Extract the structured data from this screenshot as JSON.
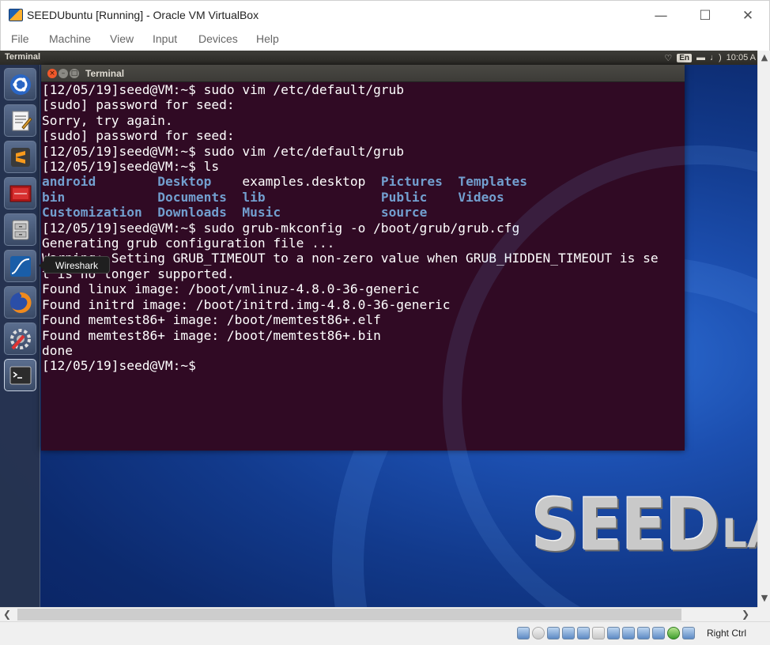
{
  "window": {
    "title": "SEEDUbuntu [Running] - Oracle VM VirtualBox",
    "controls": {
      "minimize": "—",
      "maximize": "☐",
      "close": "✕"
    }
  },
  "menu": [
    "File",
    "Machine",
    "View",
    "Input",
    "Devices",
    "Help"
  ],
  "panel": {
    "app_name": "Terminal",
    "keyboard": "En",
    "clock": "10:05 A"
  },
  "launcher": {
    "items": [
      "ubuntu-dash",
      "text-editor",
      "sublime-text",
      "terminal-red",
      "file-manager",
      "wireshark",
      "firefox",
      "system-settings",
      "terminal"
    ],
    "tooltip": "Wireshark"
  },
  "terminal": {
    "title": "Terminal",
    "lines": [
      "[12/05/19]seed@VM:~$ sudo vim /etc/default/grub",
      "[sudo] password for seed:",
      "Sorry, try again.",
      "[sudo] password for seed:",
      "[12/05/19]seed@VM:~$ sudo vim /etc/default/grub",
      "[12/05/19]seed@VM:~$ ls"
    ],
    "ls_rows": [
      [
        "android",
        "Desktop",
        "examples.desktop",
        "Pictures",
        "Templates"
      ],
      [
        "bin",
        "Documents",
        "lib",
        "Public",
        "Videos"
      ],
      [
        "Customization",
        "Downloads",
        "Music",
        "source",
        ""
      ]
    ],
    "lines_after": [
      "[12/05/19]seed@VM:~$ sudo grub-mkconfig -o /boot/grub/grub.cfg",
      "Generating grub configuration file ...",
      "Warning: Setting GRUB_TIMEOUT to a non-zero value when GRUB_HIDDEN_TIMEOUT is se",
      "t is no longer supported.",
      "Found linux image: /boot/vmlinuz-4.8.0-36-generic",
      "Found initrd image: /boot/initrd.img-4.8.0-36-generic",
      "Found memtest86+ image: /boot/memtest86+.elf",
      "Found memtest86+ image: /boot/memtest86+.bin",
      "done",
      "[12/05/19]seed@VM:~$ "
    ],
    "colors": {
      "background": "#300a24",
      "text": "#ffffff",
      "directory": "#729fcf"
    }
  },
  "wallpaper": {
    "logo_big": "SEED",
    "logo_small": "LABS"
  },
  "statusbar": {
    "icons": [
      "hard-disk",
      "optical-drive",
      "audio",
      "network",
      "usb",
      "shared-folders",
      "display",
      "video-capture",
      "recording",
      "virtualization",
      "mouse-integration",
      "host-key-arrow"
    ],
    "host_key": "Right Ctrl"
  }
}
